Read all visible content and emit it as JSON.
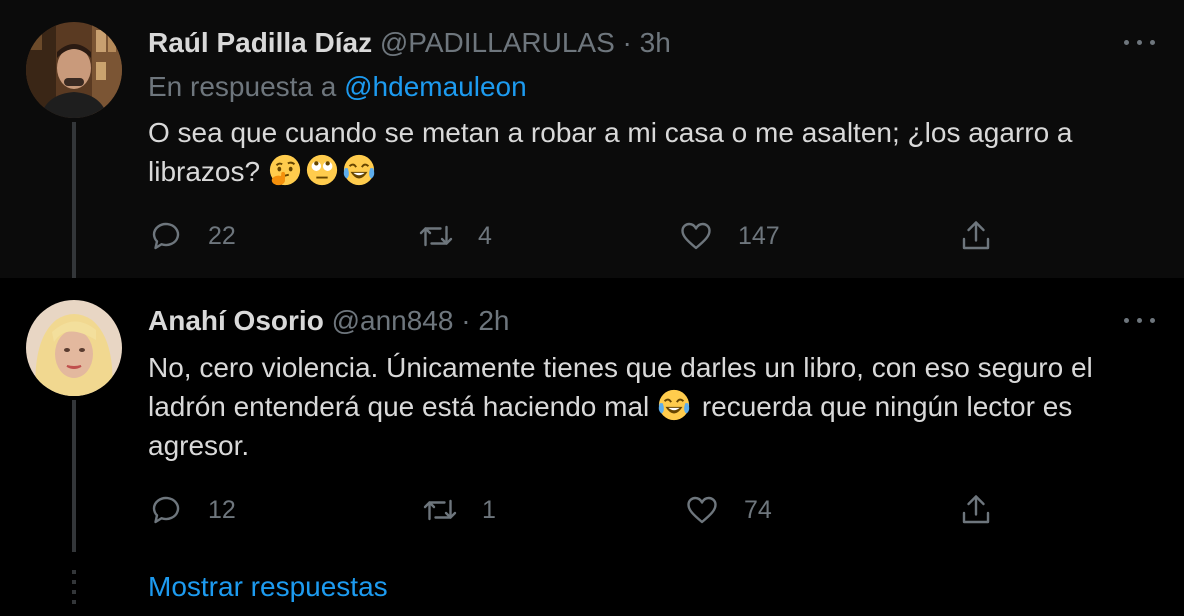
{
  "tweets": [
    {
      "display_name": "Raúl Padilla Díaz",
      "handle": "@PADILLARULAS",
      "separator": "·",
      "time": "3h",
      "reply_prefix": "En respuesta a",
      "reply_mention": "@hdemauleon",
      "text_lines": [
        "O sea que cuando se metan a robar a mi casa o me asalten; ¿los agarro a",
        "librazos?"
      ],
      "emojis": [
        "thinking-face",
        "face-with-rolling-eyes",
        "face-with-tears-of-joy"
      ],
      "replies": "22",
      "retweets": "4",
      "likes": "147"
    },
    {
      "display_name": "Anahí Osorio",
      "handle": "@ann848",
      "separator": "·",
      "time": "2h",
      "text_lines": [
        "No, cero violencia. Únicamente tienes que darles un libro, con eso seguro el",
        "ladrón entenderá que está haciendo mal",
        "recuerda que ningún lector es",
        "agresor."
      ],
      "emojis": [
        "face-with-tears-of-joy"
      ],
      "replies": "12",
      "retweets": "1",
      "likes": "74"
    }
  ],
  "show_replies_label": "Mostrar respuestas",
  "icons": {
    "reply": "reply-icon",
    "retweet": "retweet-icon",
    "like": "heart-icon",
    "share": "share-icon",
    "more": "more-icon"
  },
  "colors": {
    "background": "#000000",
    "highlighted_tweet_bg": "#0b0b0b",
    "text": "#d9d9d9",
    "secondary_text": "#6e767d",
    "link": "#1d9bf0",
    "thread_line": "#333639"
  }
}
